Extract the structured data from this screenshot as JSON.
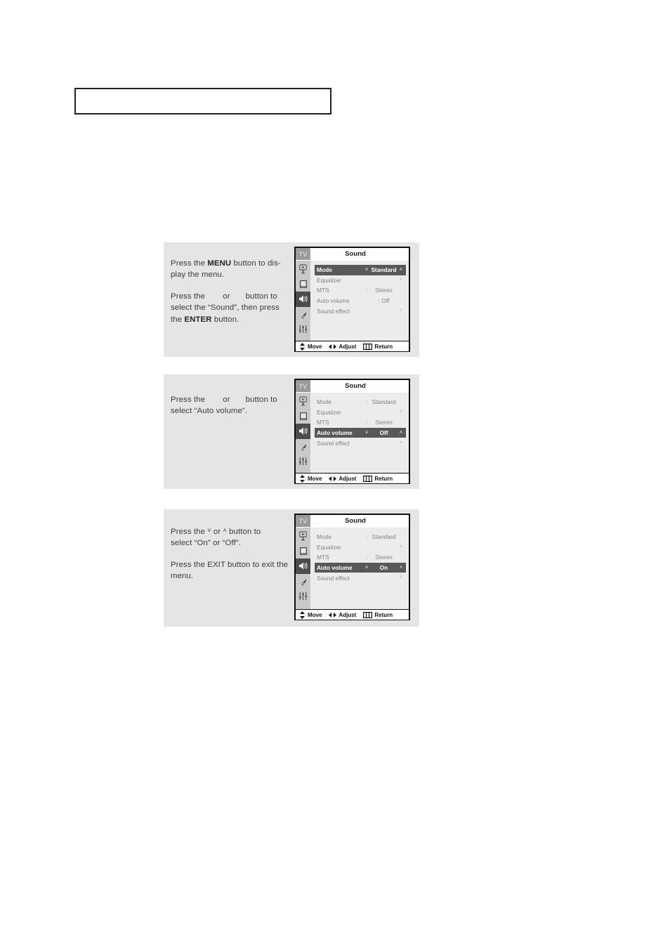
{
  "header": {
    "box_text": ""
  },
  "panels": [
    {
      "id": "panel-1",
      "instructions": [
        {
          "pre": "Press the ",
          "bold": "MENU",
          "post": " button to dis-play the menu."
        },
        {
          "pre": "Press the ",
          "bold": "",
          "post": " or  button to select the “Sound”, then press the ENTER button."
        }
      ],
      "p1_a": "Press the ",
      "p1_bold": "MENU",
      "p1_b": " button to dis-",
      "p1_c": "play the menu.",
      "p2_a": "Press the ",
      "p2_b": "or",
      "p2_c": "button to",
      "p2_d": "select the “Sound”, then press",
      "p2_e": "the ",
      "p2_bold": "ENTER",
      "p2_f": " button.",
      "osd": {
        "tv_tag": "TV",
        "title": "Sound",
        "rows": [
          {
            "label": "Mode",
            "colon": "",
            "value": "Standard",
            "caret_left": "˅",
            "caret": "˄",
            "highlight": true
          },
          {
            "label": "Equalizer",
            "colon": "",
            "value": "",
            "caret_left": "",
            "caret": "˄",
            "highlight": false
          },
          {
            "label": "MTS",
            "colon": ":",
            "value": "Stereo",
            "caret_left": "",
            "caret": "",
            "highlight": false
          },
          {
            "label": "Auto volume",
            "colon": "",
            "value": ": Off",
            "caret_left": "",
            "caret": "",
            "highlight": false
          },
          {
            "label": "Sound effect",
            "colon": "",
            "value": "",
            "caret_left": "",
            "caret": "˄",
            "highlight": false
          }
        ],
        "footer": {
          "move": "Move",
          "adjust": "Adjust",
          "return": "Return"
        },
        "rail_icons": [
          "picture-icon",
          "setup-book-icon",
          "sound-speaker-icon",
          "channel-dish-icon",
          "equalizer-sliders-icon"
        ],
        "rail_active_index": 2
      }
    },
    {
      "id": "panel-2",
      "p1_a": "Press the ",
      "p1_b": "or",
      "p1_c": "button to",
      "p1_d": "select “Auto volume”.",
      "osd": {
        "tv_tag": "TV",
        "title": "Sound",
        "rows": [
          {
            "label": "Mode",
            "colon": ":",
            "value": "Standard",
            "caret_left": "",
            "caret": "",
            "highlight": false
          },
          {
            "label": "Equalizer",
            "colon": "",
            "value": "",
            "caret_left": "",
            "caret": "˄",
            "highlight": false
          },
          {
            "label": "MTS",
            "colon": ":",
            "value": "Stereo",
            "caret_left": "",
            "caret": "",
            "highlight": false
          },
          {
            "label": "Auto volume",
            "colon": "",
            "value": "Off",
            "caret_left": "˅",
            "caret": "˄",
            "highlight": true
          },
          {
            "label": "Sound effect",
            "colon": "",
            "value": "",
            "caret_left": "",
            "caret": "˄",
            "highlight": false
          }
        ],
        "footer": {
          "move": "Move",
          "adjust": "Adjust",
          "return": "Return"
        },
        "rail_icons": [
          "picture-icon",
          "setup-book-icon",
          "sound-speaker-icon",
          "channel-dish-icon",
          "equalizer-sliders-icon"
        ],
        "rail_active_index": 2
      }
    },
    {
      "id": "panel-3",
      "p1_a": "Press the ",
      "p1_glyph_down": "˅",
      "p1_b": " or ",
      "p1_glyph_up": "˄",
      "p1_c": " button to",
      "p1_d": "select “On” or “Off”.",
      "p2_a": "Press the EXIT button to exit the",
      "p2_b": "menu.",
      "osd": {
        "tv_tag": "TV",
        "title": "Sound",
        "rows": [
          {
            "label": "Mode",
            "colon": ":",
            "value": "Standard",
            "caret_left": "",
            "caret": "",
            "highlight": false
          },
          {
            "label": "Equalizer",
            "colon": "",
            "value": "",
            "caret_left": "",
            "caret": "˄",
            "highlight": false
          },
          {
            "label": "MTS",
            "colon": ":",
            "value": "Stereo",
            "caret_left": "",
            "caret": "",
            "highlight": false
          },
          {
            "label": "Auto volume",
            "colon": "",
            "value": "On",
            "caret_left": "˅",
            "caret": "˄",
            "highlight": true
          },
          {
            "label": "Sound effect",
            "colon": "",
            "value": "",
            "caret_left": "",
            "caret": "˄",
            "highlight": false
          }
        ],
        "footer": {
          "move": "Move",
          "adjust": "Adjust",
          "return": "Return"
        },
        "rail_icons": [
          "picture-icon",
          "setup-book-icon",
          "sound-speaker-icon",
          "channel-dish-icon",
          "equalizer-sliders-icon"
        ],
        "rail_active_index": 2
      }
    }
  ],
  "colors": {
    "panel_bg": "#e5e5e5",
    "osd_bg": "#ececec",
    "osd_border": "#0f0f0f",
    "rail_bg": "#c9c9c9",
    "rail_active": "#4c4c4c",
    "row_highlight": "#585858",
    "text_gray": "#818181",
    "text_dark": "#231f20"
  }
}
